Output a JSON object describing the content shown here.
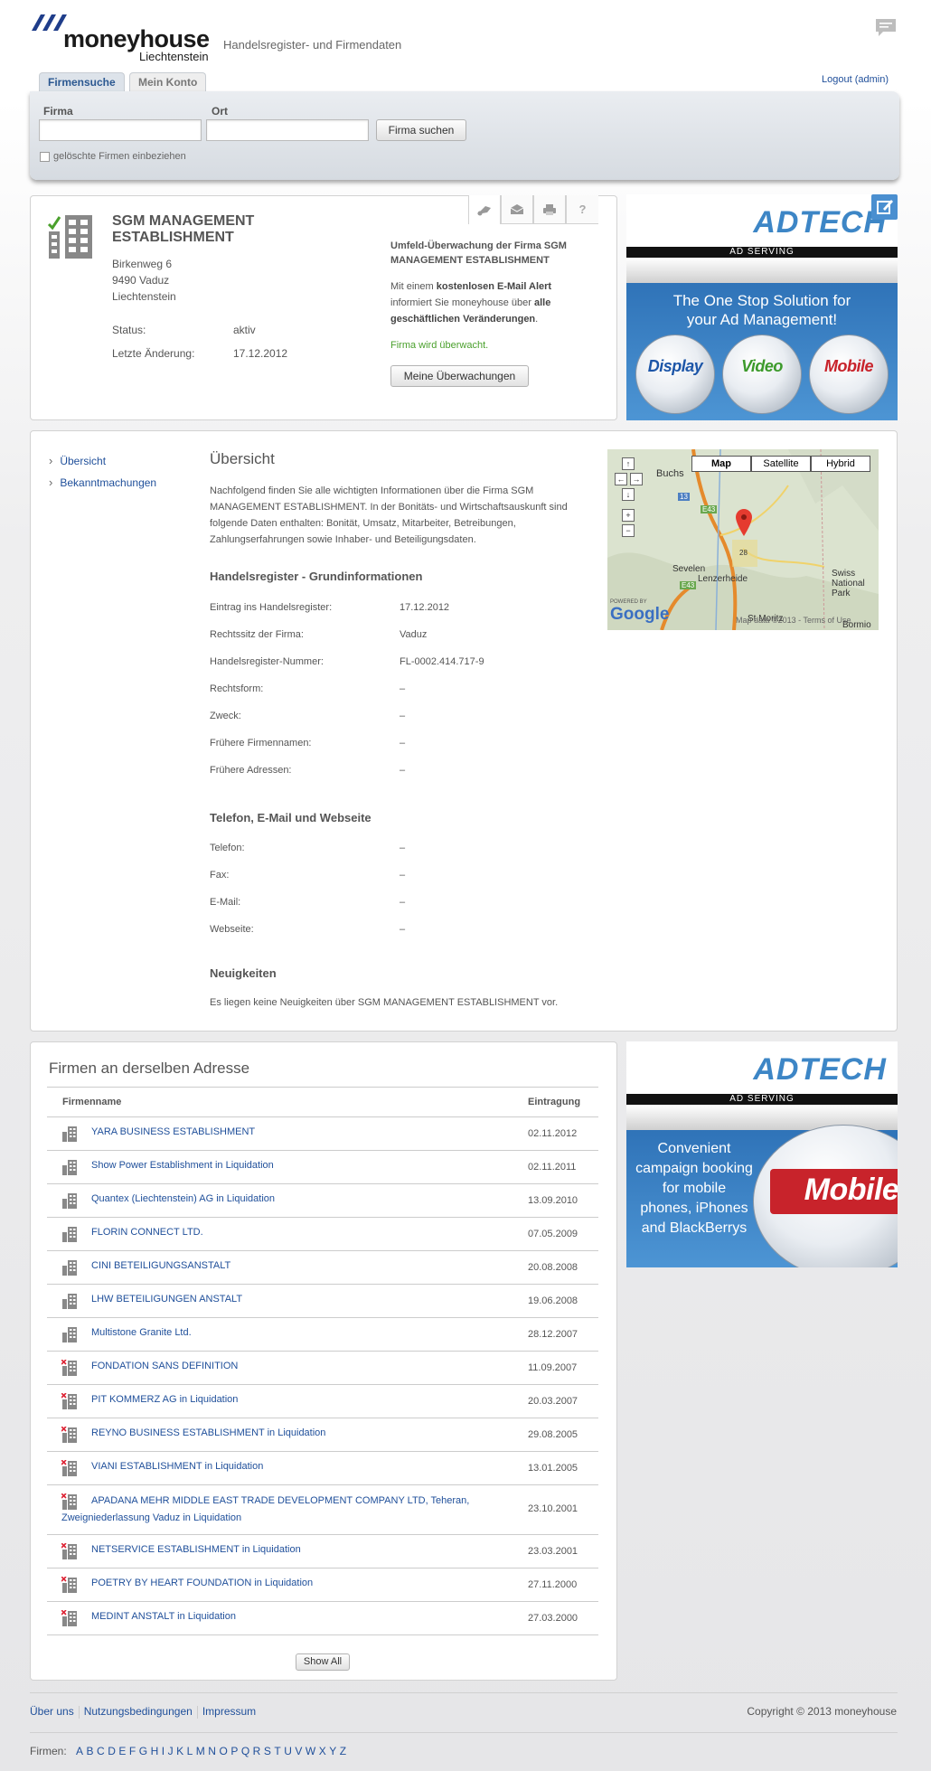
{
  "header": {
    "logo_name": "moneyhouse",
    "logo_sub": "Liechtenstein",
    "tagline": "Handelsregister- und Firmendaten",
    "chat_icon": "chat-icon"
  },
  "tabs": [
    {
      "label": "Firmensuche",
      "active": true
    },
    {
      "label": "Mein Konto",
      "active": false
    }
  ],
  "logout": "Logout (admin)",
  "search": {
    "firma_label": "Firma",
    "ort_label": "Ort",
    "firma_value": "",
    "ort_value": "",
    "button": "Firma suchen",
    "checkbox_label": "gelöschte Firmen einbeziehen"
  },
  "company": {
    "name": "SGM MANAGEMENT ESTABLISHMENT",
    "street": "Birkenweg 6",
    "city": "9490 Vaduz",
    "country": "Liechtenstein",
    "status_label": "Status:",
    "status_value": "aktiv",
    "change_label": "Letzte Änderung:",
    "change_value": "17.12.2012",
    "icons": [
      "binoculars-icon",
      "envelope-icon",
      "printer-icon",
      "help-icon"
    ]
  },
  "monitoring": {
    "title": "Umfeld-Überwachung der Firma SGM MANAGEMENT ESTABLISHMENT",
    "text_1": "Mit einem ",
    "text_bold_1": "kostenlosen E-Mail Alert",
    "text_2": " informiert Sie moneyhouse über ",
    "text_bold_2": "alle geschäftlichen Veränderungen",
    "text_3": ".",
    "status": "Firma wird überwacht.",
    "button": "Meine Überwachungen"
  },
  "ad1": {
    "logo": "ADTECH",
    "strip": "AD SERVING",
    "headline": "The One Stop Solution for your Ad Management!",
    "balls": [
      "Display",
      "Video",
      "Mobile"
    ]
  },
  "ad2": {
    "logo": "ADTECH",
    "strip": "AD SERVING",
    "headline": "Convenient campaign booking for mobile phones, iPhones and BlackBerrys",
    "ball": "Mobile"
  },
  "nav": [
    {
      "label": "Übersicht"
    },
    {
      "label": "Bekanntmachungen"
    }
  ],
  "overview": {
    "title": "Übersicht",
    "intro": "Nachfolgend finden Sie alle wichtigten Informationen über die Firma SGM MANAGEMENT ESTABLISHMENT. In der Bonitäts- und Wirtschaftsauskunft sind folgende Daten enthalten: Bonität, Umsatz, Mitarbeiter, Betreibungen, Zahlungserfahrungen sowie Inhaber- und Beteiligungsdaten.",
    "hr_title": "Handelsregister - Grundinformationen",
    "hr_rows": [
      {
        "label": "Eintrag ins Handelsregister:",
        "value": "17.12.2012"
      },
      {
        "label": "Rechtssitz der Firma:",
        "value": "Vaduz"
      },
      {
        "label": "Handelsregister-Nummer:",
        "value": "FL-0002.414.717-9"
      },
      {
        "label": "Rechtsform:",
        "value": "–"
      },
      {
        "label": "Zweck:",
        "value": "–"
      },
      {
        "label": "Frühere Firmennamen:",
        "value": "–"
      },
      {
        "label": "Frühere Adressen:",
        "value": "–"
      }
    ],
    "contact_title": "Telefon, E-Mail und Webseite",
    "contact_rows": [
      {
        "label": "Telefon:",
        "value": "–"
      },
      {
        "label": "Fax:",
        "value": "–"
      },
      {
        "label": "E-Mail:",
        "value": "–"
      },
      {
        "label": "Webseite:",
        "value": "–"
      }
    ],
    "news_title": "Neuigkeiten",
    "news_text": "Es liegen keine Neuigkeiten über SGM MANAGEMENT ESTABLISHMENT vor."
  },
  "map": {
    "buttons": [
      "Map",
      "Satellite",
      "Hybrid"
    ],
    "places": [
      "Buchs",
      "Sevelen",
      "Lenzerheide",
      "Swiss National Park",
      "St.Moritz",
      "Bormio",
      "E43",
      "13",
      "28"
    ],
    "powered": "POWERED BY",
    "google": "Google",
    "attribution": "Map data ©2013 - Terms of Use"
  },
  "related": {
    "title": "Firmen an derselben Adresse",
    "col_name": "Firmenname",
    "col_date": "Eintragung",
    "rows": [
      {
        "name": "YARA BUSINESS ESTABLISHMENT",
        "date": "02.11.2012",
        "deleted": false
      },
      {
        "name": "Show Power Establishment in Liquidation",
        "date": "02.11.2011",
        "deleted": false
      },
      {
        "name": "Quantex (Liechtenstein) AG in Liquidation",
        "date": "13.09.2010",
        "deleted": false
      },
      {
        "name": "FLORIN CONNECT LTD.",
        "date": "07.05.2009",
        "deleted": false
      },
      {
        "name": "CINI BETEILIGUNGSANSTALT",
        "date": "20.08.2008",
        "deleted": false
      },
      {
        "name": "LHW BETEILIGUNGEN ANSTALT",
        "date": "19.06.2008",
        "deleted": false
      },
      {
        "name": "Multistone Granite Ltd.",
        "date": "28.12.2007",
        "deleted": false
      },
      {
        "name": "FONDATION SANS DEFINITION",
        "date": "11.09.2007",
        "deleted": true
      },
      {
        "name": "PIT KOMMERZ AG in Liquidation",
        "date": "20.03.2007",
        "deleted": true
      },
      {
        "name": "REYNO BUSINESS ESTABLISHMENT in Liquidation",
        "date": "29.08.2005",
        "deleted": true
      },
      {
        "name": "VIANI ESTABLISHMENT in Liquidation",
        "date": "13.01.2005",
        "deleted": true
      },
      {
        "name": "APADANA MEHR MIDDLE EAST TRADE DEVELOPMENT COMPANY LTD, Teheran, Zweigniederlassung Vaduz in Liquidation",
        "date": "23.10.2001",
        "deleted": true
      },
      {
        "name": "NETSERVICE ESTABLISHMENT in Liquidation",
        "date": "23.03.2001",
        "deleted": true
      },
      {
        "name": "POETRY BY HEART FOUNDATION in Liquidation",
        "date": "27.11.2000",
        "deleted": true
      },
      {
        "name": "MEDINT ANSTALT in Liquidation",
        "date": "27.03.2000",
        "deleted": true
      }
    ],
    "show_all": "Show All"
  },
  "footer": {
    "links": [
      "Über uns",
      "Nutzungsbedingungen",
      "Impressum"
    ],
    "copyright": "Copyright © 2013 moneyhouse",
    "firmen_label": "Firmen:",
    "letters": [
      "A",
      "B",
      "C",
      "D",
      "E",
      "F",
      "G",
      "H",
      "I",
      "J",
      "K",
      "L",
      "M",
      "N",
      "O",
      "P",
      "Q",
      "R",
      "S",
      "T",
      "U",
      "V",
      "W",
      "X",
      "Y",
      "Z"
    ]
  }
}
